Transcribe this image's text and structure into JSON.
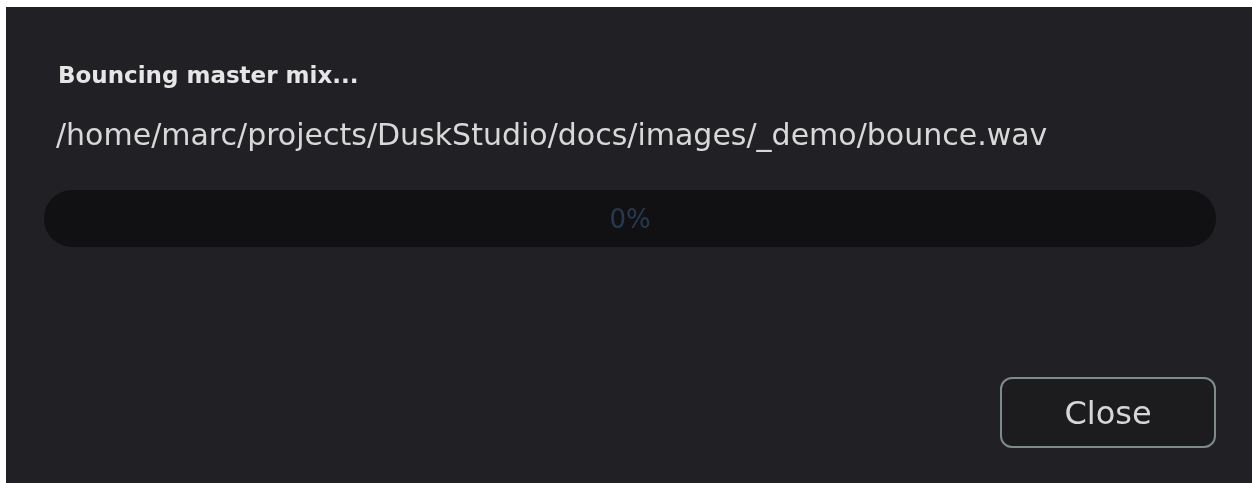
{
  "dialog": {
    "title": "Bouncing master mix...",
    "path": "/home/marc/projects/DuskStudio/docs/images/_demo/bounce.wav",
    "progress": {
      "level": 0,
      "reading": "0%"
    },
    "buttons": [
      {
        "label": "Close"
      }
    ]
  }
}
